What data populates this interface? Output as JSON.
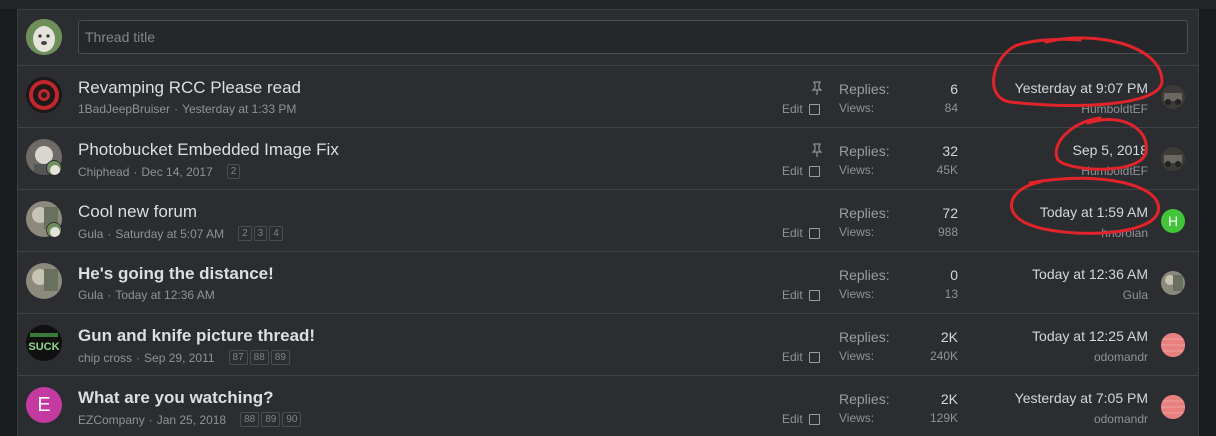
{
  "new_thread": {
    "placeholder": "Thread title"
  },
  "labels": {
    "replies": "Replies:",
    "views": "Views:",
    "edit": "Edit"
  },
  "threads": [
    {
      "title": "Revamping RCC Please read",
      "author": "1BadJeepBruiser",
      "started": "Yesterday at 1:33 PM",
      "sticky": true,
      "replies": "6",
      "views": "84",
      "last_date": "Yesterday at 9:07 PM",
      "last_user": "HumboldtEF",
      "pages": []
    },
    {
      "title": "Photobucket Embedded Image Fix",
      "author": "Chiphead",
      "started": "Dec 14, 2017",
      "sticky": true,
      "replies": "32",
      "views": "45K",
      "last_date": "Sep 5, 2018",
      "last_user": "HumboldtEF",
      "pages": [
        "2"
      ]
    },
    {
      "title": "Cool new forum",
      "author": "Gula",
      "started": "Saturday at 5:07 AM",
      "sticky": false,
      "replies": "72",
      "views": "988",
      "last_date": "Today at 1:59 AM",
      "last_user": "hnoroian",
      "last_avatar_letter": "H",
      "pages": [
        "2",
        "3",
        "4"
      ]
    },
    {
      "title": "He's going the distance!",
      "author": "Gula",
      "started": "Today at 12:36 AM",
      "sticky": false,
      "replies": "0",
      "views": "13",
      "last_date": "Today at 12:36 AM",
      "last_user": "Gula",
      "pages": []
    },
    {
      "title": "Gun and knife picture thread!",
      "author": "chip cross",
      "started": "Sep 29, 2011",
      "sticky": false,
      "replies": "2K",
      "views": "240K",
      "last_date": "Today at 12:25 AM",
      "last_user": "odomandr",
      "avatar_text": "SUCK",
      "pages": [
        "87",
        "88",
        "89"
      ]
    },
    {
      "title": "What are you watching?",
      "author": "EZCompany",
      "started": "Jan 25, 2018",
      "sticky": false,
      "replies": "2K",
      "views": "129K",
      "last_date": "Yesterday at 7:05 PM",
      "last_user": "odomandr",
      "avatar_letter": "E",
      "pages": [
        "88",
        "89",
        "90"
      ]
    }
  ],
  "colors": {
    "background": "#2b2d31",
    "annotation": "#e0242a",
    "avatar_green": "#43c43a",
    "avatar_magenta": "#c53aa0",
    "avatar_salmon": "#e88080"
  }
}
